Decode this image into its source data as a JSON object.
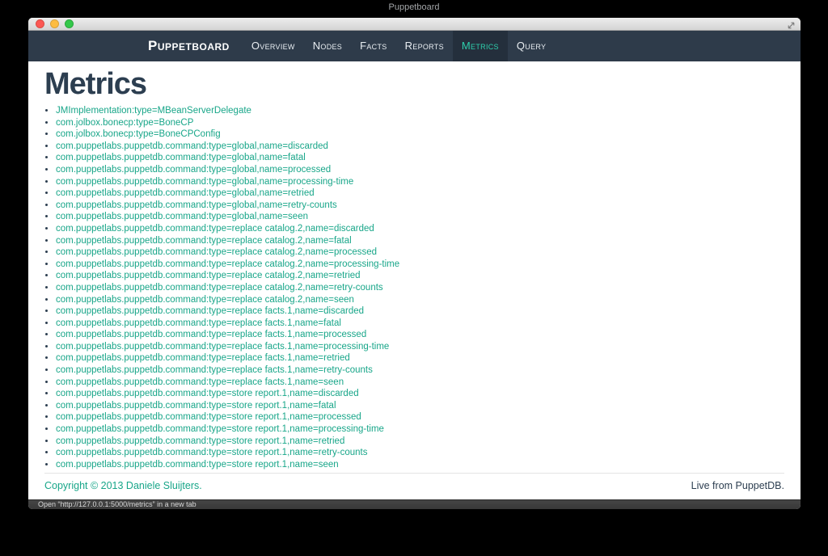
{
  "window": {
    "title": "Puppetboard",
    "status_text": "Open “http://127.0.0.1:5000/metrics” in a new tab"
  },
  "navbar": {
    "brand": "Puppetboard",
    "items": [
      {
        "label": "Overview",
        "active": false
      },
      {
        "label": "Nodes",
        "active": false
      },
      {
        "label": "Facts",
        "active": false
      },
      {
        "label": "Reports",
        "active": false
      },
      {
        "label": "Metrics",
        "active": true
      },
      {
        "label": "Query",
        "active": false
      }
    ]
  },
  "page": {
    "heading": "Metrics",
    "metrics": [
      "JMImplementation:type=MBeanServerDelegate",
      "com.jolbox.bonecp:type=BoneCP",
      "com.jolbox.bonecp:type=BoneCPConfig",
      "com.puppetlabs.puppetdb.command:type=global,name=discarded",
      "com.puppetlabs.puppetdb.command:type=global,name=fatal",
      "com.puppetlabs.puppetdb.command:type=global,name=processed",
      "com.puppetlabs.puppetdb.command:type=global,name=processing-time",
      "com.puppetlabs.puppetdb.command:type=global,name=retried",
      "com.puppetlabs.puppetdb.command:type=global,name=retry-counts",
      "com.puppetlabs.puppetdb.command:type=global,name=seen",
      "com.puppetlabs.puppetdb.command:type=replace catalog.2,name=discarded",
      "com.puppetlabs.puppetdb.command:type=replace catalog.2,name=fatal",
      "com.puppetlabs.puppetdb.command:type=replace catalog.2,name=processed",
      "com.puppetlabs.puppetdb.command:type=replace catalog.2,name=processing-time",
      "com.puppetlabs.puppetdb.command:type=replace catalog.2,name=retried",
      "com.puppetlabs.puppetdb.command:type=replace catalog.2,name=retry-counts",
      "com.puppetlabs.puppetdb.command:type=replace catalog.2,name=seen",
      "com.puppetlabs.puppetdb.command:type=replace facts.1,name=discarded",
      "com.puppetlabs.puppetdb.command:type=replace facts.1,name=fatal",
      "com.puppetlabs.puppetdb.command:type=replace facts.1,name=processed",
      "com.puppetlabs.puppetdb.command:type=replace facts.1,name=processing-time",
      "com.puppetlabs.puppetdb.command:type=replace facts.1,name=retried",
      "com.puppetlabs.puppetdb.command:type=replace facts.1,name=retry-counts",
      "com.puppetlabs.puppetdb.command:type=replace facts.1,name=seen",
      "com.puppetlabs.puppetdb.command:type=store report.1,name=discarded",
      "com.puppetlabs.puppetdb.command:type=store report.1,name=fatal",
      "com.puppetlabs.puppetdb.command:type=store report.1,name=processed",
      "com.puppetlabs.puppetdb.command:type=store report.1,name=processing-time",
      "com.puppetlabs.puppetdb.command:type=store report.1,name=retried",
      "com.puppetlabs.puppetdb.command:type=store report.1,name=retry-counts",
      "com.puppetlabs.puppetdb.command:type=store report.1,name=seen"
    ]
  },
  "footer": {
    "copyright": "Copyright © 2013 Daniele Sluijters.",
    "live": "Live from PuppetDB."
  },
  "colors": {
    "accent": "#18a689",
    "accent_active": "#2ecfad",
    "navbar_bg": "#2e3b4a",
    "heading": "#2c3e50"
  }
}
